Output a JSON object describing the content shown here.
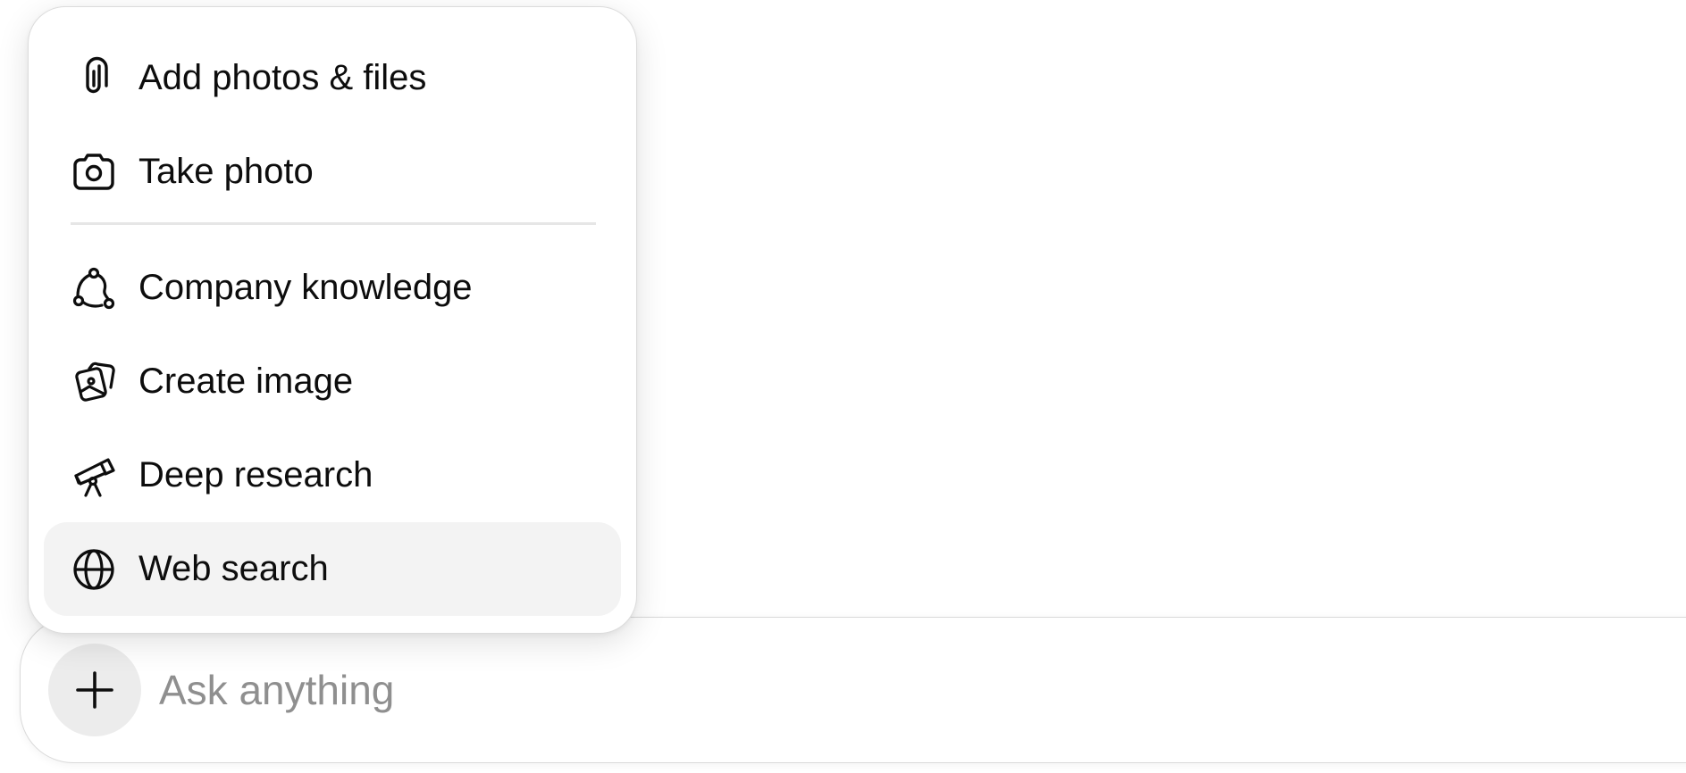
{
  "menu": {
    "items": [
      {
        "label": "Add photos & files",
        "icon": "paperclip-icon"
      },
      {
        "label": "Take photo",
        "icon": "camera-icon"
      },
      {
        "label": "Company knowledge",
        "icon": "knowledge-graph-icon"
      },
      {
        "label": "Create image",
        "icon": "image-create-icon"
      },
      {
        "label": "Deep research",
        "icon": "telescope-icon"
      },
      {
        "label": "Web search",
        "icon": "globe-icon",
        "highlighted": true
      }
    ]
  },
  "composer": {
    "placeholder": "Ask anything",
    "value": "",
    "plus_button_icon": "plus-icon"
  },
  "colors": {
    "highlight_bg": "#f3f3f3",
    "plus_button_bg": "#ececec",
    "placeholder_text": "#8f8f8f",
    "text": "#0d0d0d"
  }
}
